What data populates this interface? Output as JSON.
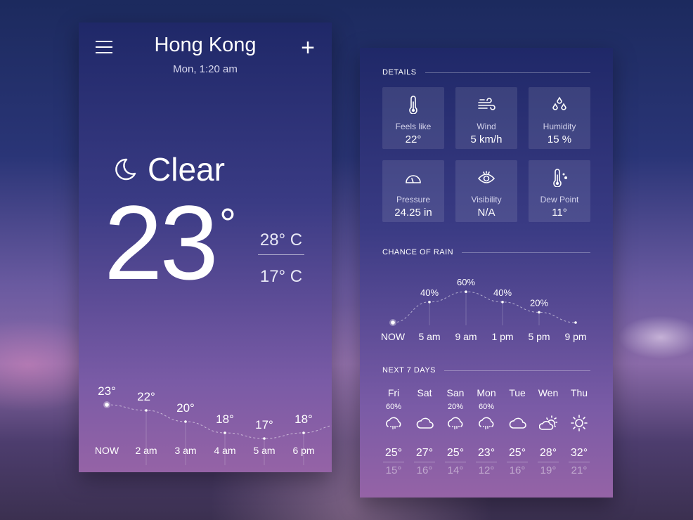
{
  "header": {
    "city": "Hong Kong",
    "datetime": "Mon, 1:20 am"
  },
  "current": {
    "condition": "Clear",
    "condition_icon": "moon-icon",
    "temp": "23",
    "deg": "°",
    "high": "28° C",
    "low": "17° C"
  },
  "hourly": {
    "labels": [
      "NOW",
      "2 am",
      "3 am",
      "4 am",
      "5 am",
      "6 pm"
    ],
    "temps": [
      23,
      22,
      20,
      18,
      17,
      18
    ]
  },
  "details": {
    "title": "DETAILS",
    "items": [
      {
        "icon": "thermometer-icon",
        "label": "Feels like",
        "value": "22°"
      },
      {
        "icon": "wind-icon",
        "label": "Wind",
        "value": "5 km/h"
      },
      {
        "icon": "humidity-icon",
        "label": "Humidity",
        "value": "15 %"
      },
      {
        "icon": "gauge-icon",
        "label": "Pressure",
        "value": "24.25 in"
      },
      {
        "icon": "eye-icon",
        "label": "Visibility",
        "value": "N/A"
      },
      {
        "icon": "dew-point-icon",
        "label": "Dew Point",
        "value": "11°"
      }
    ]
  },
  "rain": {
    "title": "CHANCE OF RAIN",
    "labels": [
      "NOW",
      "5 am",
      "9 am",
      "1 pm",
      "5 pm",
      "9 pm"
    ],
    "values": [
      0,
      40,
      60,
      40,
      20,
      0
    ],
    "shown": [
      null,
      "40%",
      "60%",
      "40%",
      "20%",
      null
    ]
  },
  "week": {
    "title": "NEXT 7 DAYS",
    "days": [
      {
        "name": "Fri",
        "chance": "60%",
        "icon": "rain",
        "high": "25°",
        "low": "15°"
      },
      {
        "name": "Sat",
        "chance": "",
        "icon": "cloud",
        "high": "27°",
        "low": "16°"
      },
      {
        "name": "San",
        "chance": "20%",
        "icon": "rain",
        "high": "25°",
        "low": "14°"
      },
      {
        "name": "Mon",
        "chance": "60%",
        "icon": "rain",
        "high": "23°",
        "low": "12°"
      },
      {
        "name": "Tue",
        "chance": "",
        "icon": "cloud",
        "high": "25°",
        "low": "16°"
      },
      {
        "name": "Wen",
        "chance": "",
        "icon": "partly-cloudy",
        "high": "28°",
        "low": "19°"
      },
      {
        "name": "Thu",
        "chance": "",
        "icon": "sun",
        "high": "32°",
        "low": "21°"
      }
    ]
  }
}
